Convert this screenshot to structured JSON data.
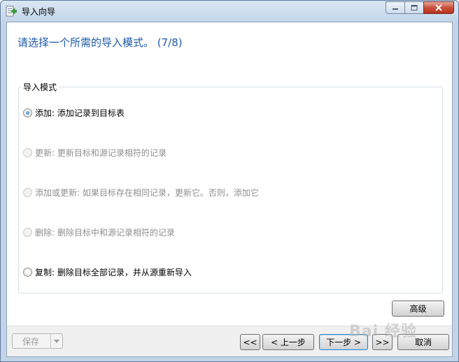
{
  "window": {
    "title": "导入向导"
  },
  "header": {
    "title": "请选择一个所需的导入模式。 (7/8)"
  },
  "group": {
    "label": "导入模式",
    "options": [
      {
        "label": "添加: 添加记录到目标表",
        "checked": true,
        "enabled": true
      },
      {
        "label": "更新: 更新目标和源记录相符的记录",
        "checked": false,
        "enabled": false
      },
      {
        "label": "添加或更新: 如果目标存在相同记录，更新它。否则，添加它",
        "checked": false,
        "enabled": false
      },
      {
        "label": "删除: 删除目标中和源记录相符的记录",
        "checked": false,
        "enabled": false
      },
      {
        "label": "复制: 删除目标全部记录，并从源重新导入",
        "checked": false,
        "enabled": true
      }
    ]
  },
  "buttons": {
    "advanced": "高级",
    "save": "保存",
    "first": "<<",
    "prev": "< 上一步",
    "next": "下一步 >",
    "last": ">>",
    "cancel": "取消"
  },
  "watermark": "Bai 经验"
}
